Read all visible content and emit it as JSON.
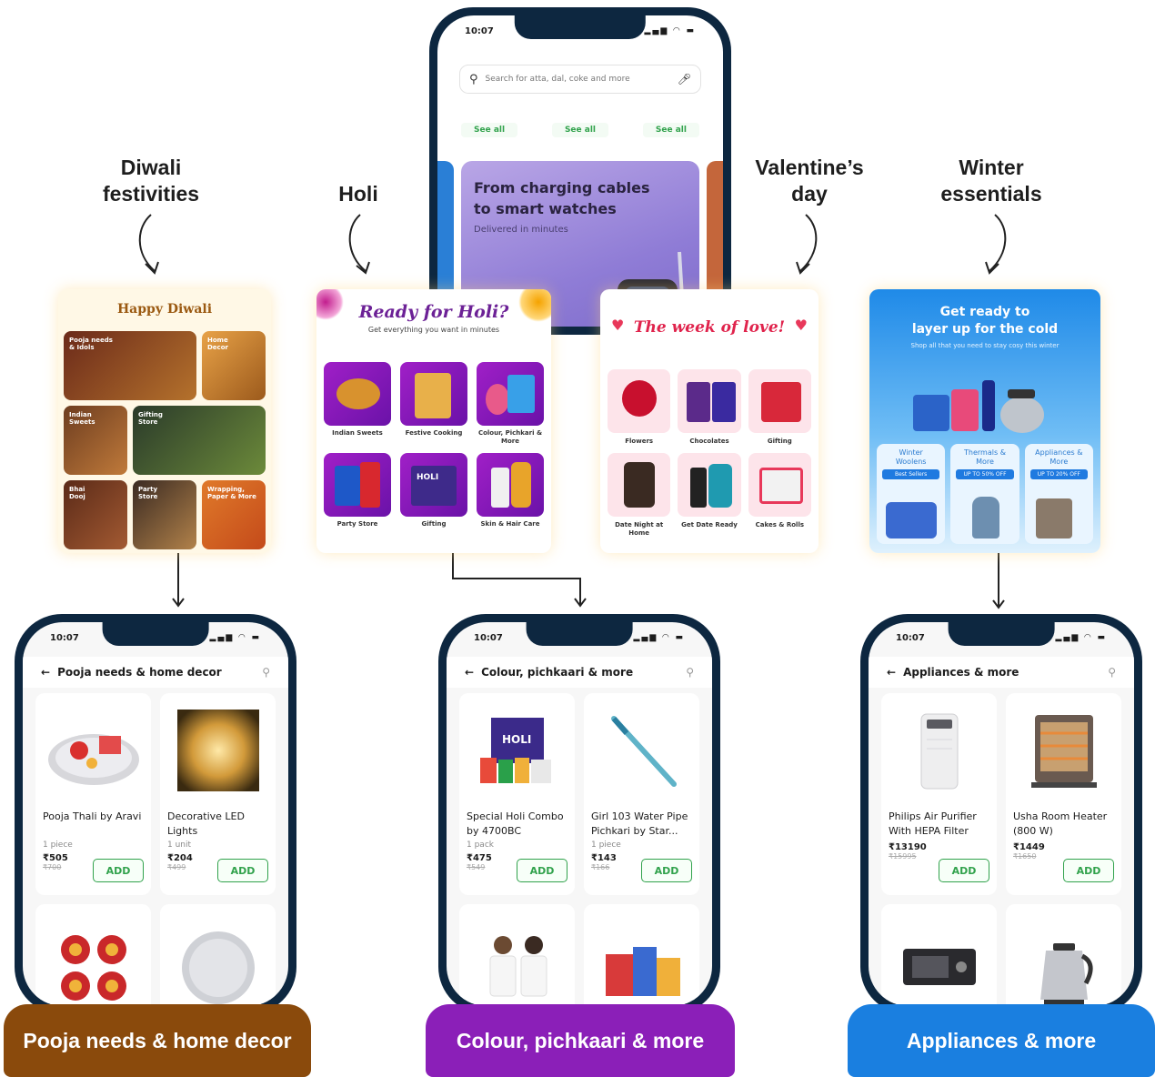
{
  "annotations": {
    "diwali": [
      "Diwali",
      "festivities"
    ],
    "holi": "Holi",
    "valentine": [
      "Valentine’s",
      "day"
    ],
    "winter": [
      "Winter",
      "essentials"
    ]
  },
  "top_phone": {
    "time": "10:07",
    "search_placeholder": "Search for atta, dal, coke and more",
    "see_all": [
      "See all",
      "See all",
      "See all"
    ],
    "promo_title": [
      "From charging cables",
      "to smart watches"
    ],
    "promo_sub": "Delivered in minutes"
  },
  "diwali_card": {
    "title": "Happy Diwali",
    "tiles": [
      "Pooja needs & Idols",
      "Home Decor",
      "Indian Sweets",
      "Gifting Store",
      "Bhai Dooj",
      "Party Store",
      "Wrapping, Paper & More"
    ]
  },
  "holi_card": {
    "title": "Ready for Holi?",
    "subtitle": "Get everything you want in minutes",
    "tiles": [
      "Indian Sweets",
      "Festive Cooking",
      "Colour, Pichkari & More",
      "Party Store",
      "Gifting",
      "Skin & Hair Care"
    ]
  },
  "valentine_card": {
    "title": "The week of love!",
    "tiles": [
      "Flowers",
      "Chocolates",
      "Gifting",
      "Date Night at Home",
      "Get Date Ready",
      "Cakes & Rolls"
    ]
  },
  "winter_card": {
    "title": [
      "Get ready to",
      "layer up for the cold"
    ],
    "subtitle": "Shop all that you need to stay cosy this winter",
    "tiles": [
      {
        "label": "Winter Woolens",
        "badge": "Best Sellers"
      },
      {
        "label": "Thermals & More",
        "badge": "UP TO 50% OFF"
      },
      {
        "label": "Appliances & More",
        "badge": "UP TO 20% OFF"
      }
    ]
  },
  "phones": [
    {
      "time": "10:07",
      "title": "Pooja needs & home decor",
      "banner": "Pooja needs & home decor",
      "banner_color": "#8a4a0c",
      "products": [
        {
          "name": "Pooja Thali by Aravi",
          "qty": "1 piece",
          "price": "₹505",
          "mrp": "₹700",
          "add": "ADD"
        },
        {
          "name": "Decorative LED Lights",
          "qty": "1 unit",
          "price": "₹204",
          "mrp": "₹499",
          "add": "ADD"
        }
      ]
    },
    {
      "time": "10:07",
      "title": "Colour, pichkaari & more",
      "banner": "Colour, pichkaari & more",
      "banner_color": "#8b1fb8",
      "products": [
        {
          "name": "Special Holi Combo by 4700BC",
          "qty": "1 pack",
          "price": "₹475",
          "mrp": "₹549",
          "add": "ADD"
        },
        {
          "name": "Girl 103 Water Pipe Pichkari by Star...",
          "qty": "1 piece",
          "price": "₹143",
          "mrp": "₹166",
          "add": "ADD"
        }
      ]
    },
    {
      "time": "10:07",
      "title": "Appliances & more",
      "banner": "Appliances & more",
      "banner_color": "#1a7fe0",
      "products": [
        {
          "name": "Philips Air Purifier With HEPA Filter",
          "qty": "",
          "price": "₹13190",
          "mrp": "₹15995",
          "add": "ADD"
        },
        {
          "name": "Usha Room Heater (800 W)",
          "qty": "",
          "price": "₹1449",
          "mrp": "₹1650",
          "add": "ADD"
        }
      ]
    }
  ]
}
